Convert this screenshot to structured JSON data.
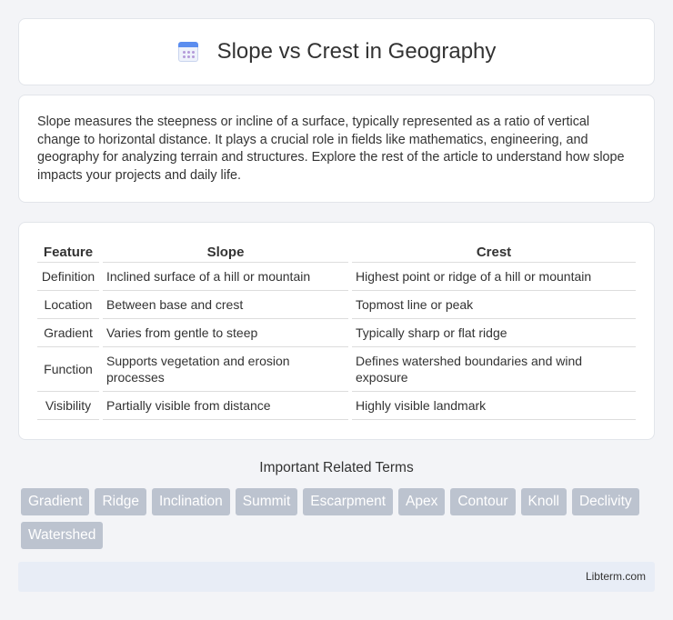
{
  "header": {
    "title": "Slope vs Crest in Geography",
    "icon": "calendar-icon"
  },
  "intro": {
    "text": "Slope measures the steepness or incline of a surface, typically represented as a ratio of vertical change to horizontal distance. It plays a crucial role in fields like mathematics, engineering, and geography for analyzing terrain and structures. Explore the rest of the article to understand how slope impacts your projects and daily life."
  },
  "table": {
    "headers": [
      "Feature",
      "Slope",
      "Crest"
    ],
    "rows": [
      [
        "Definition",
        "Inclined surface of a hill or mountain",
        "Highest point or ridge of a hill or mountain"
      ],
      [
        "Location",
        "Between base and crest",
        "Topmost line or peak"
      ],
      [
        "Gradient",
        "Varies from gentle to steep",
        "Typically sharp or flat ridge"
      ],
      [
        "Function",
        "Supports vegetation and erosion processes",
        "Defines watershed boundaries and wind exposure"
      ],
      [
        "Visibility",
        "Partially visible from distance",
        "Highly visible landmark"
      ]
    ]
  },
  "related": {
    "title": "Important Related Terms",
    "tags": [
      "Gradient",
      "Ridge",
      "Inclination",
      "Summit",
      "Escarpment",
      "Apex",
      "Contour",
      "Knoll",
      "Declivity",
      "Watershed"
    ]
  },
  "footer": {
    "text": "Libterm.com"
  },
  "colors": {
    "tag_bg": "#bcc3cf",
    "footer_bg": "#e8edf6",
    "icon_accent": "#5b8def"
  }
}
